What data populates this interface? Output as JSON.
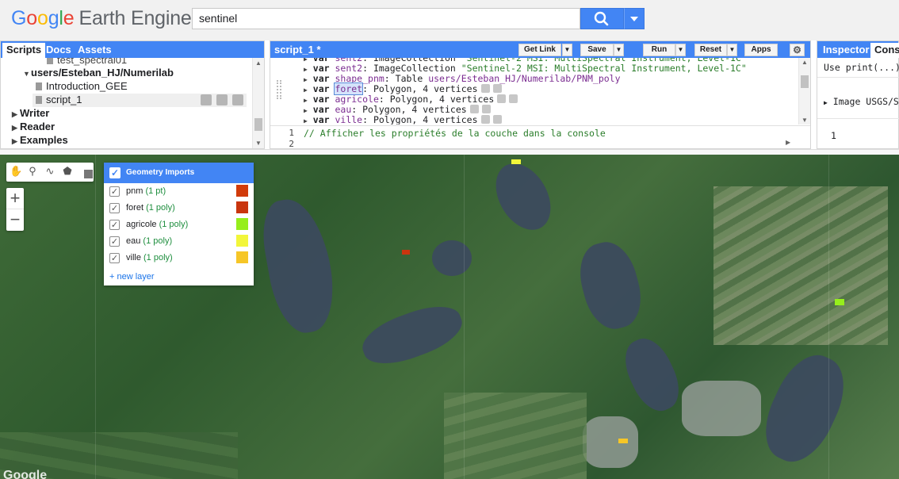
{
  "header": {
    "logo": {
      "g1": "G",
      "g2": "o",
      "g3": "o",
      "g4": "g",
      "g5": "l",
      "g6": "e",
      "product": "Earth Engine"
    },
    "search_value": "sentinel"
  },
  "left_panel": {
    "tabs": [
      "Scripts",
      "Docs",
      "Assets"
    ],
    "tree": {
      "partial_item": "test_spectral01",
      "repo": "users/Esteban_HJ/Numerilab",
      "files": [
        "Introduction_GEE",
        "script_1"
      ],
      "folders": [
        "Writer",
        "Reader",
        "Examples"
      ]
    }
  },
  "editor": {
    "title": "script_1 *",
    "buttons": {
      "get_link": "Get Link",
      "save": "Save",
      "run": "Run",
      "reset": "Reset",
      "apps": "Apps"
    },
    "imports": [
      {
        "kw": "var",
        "name": "sent2",
        "rest": ": ImageCollection ",
        "str": "\"Sentinel-2 MSI: MultiSpectral Instrument, Level-1C\""
      },
      {
        "kw": "var",
        "name": "shape_pnm",
        "rest": ": Table ",
        "str": "users/Esteban_HJ/Numerilab/PNM_poly"
      },
      {
        "kw": "var",
        "name": "foret",
        "rest": ": Polygon, 4 vertices",
        "str": ""
      },
      {
        "kw": "var",
        "name": "agricole",
        "rest": ": Polygon, 4 vertices",
        "str": ""
      },
      {
        "kw": "var",
        "name": "eau",
        "rest": ": Polygon, 4 vertices",
        "str": ""
      },
      {
        "kw": "var",
        "name": "ville",
        "rest": ": Polygon, 4 vertices",
        "str": ""
      }
    ],
    "lines": [
      {
        "no": "1",
        "text": "// Afficher les propriétés de la couche dans la console"
      },
      {
        "no": "2",
        "text": ""
      }
    ]
  },
  "right_panel": {
    "tabs": [
      "Inspector",
      "Console"
    ],
    "console": {
      "line1": "Use print(...)",
      "line2": "Image USGS/SR",
      "line3": "1"
    }
  },
  "map": {
    "geometry_imports": {
      "title": "Geometry Imports",
      "layers": [
        {
          "name": "pnm",
          "count": "(1 pt)",
          "color": "#d13b0a"
        },
        {
          "name": "foret",
          "count": "(1 poly)",
          "color": "#c9350e"
        },
        {
          "name": "agricole",
          "count": "(1 poly)",
          "color": "#96ee1c"
        },
        {
          "name": "eau",
          "count": "(1 poly)",
          "color": "#f2f63a"
        },
        {
          "name": "ville",
          "count": "(1 poly)",
          "color": "#f6c627"
        }
      ],
      "new_layer": "+ new layer"
    },
    "zoom": {
      "in": "+",
      "out": "−"
    },
    "attribution": "Google"
  }
}
